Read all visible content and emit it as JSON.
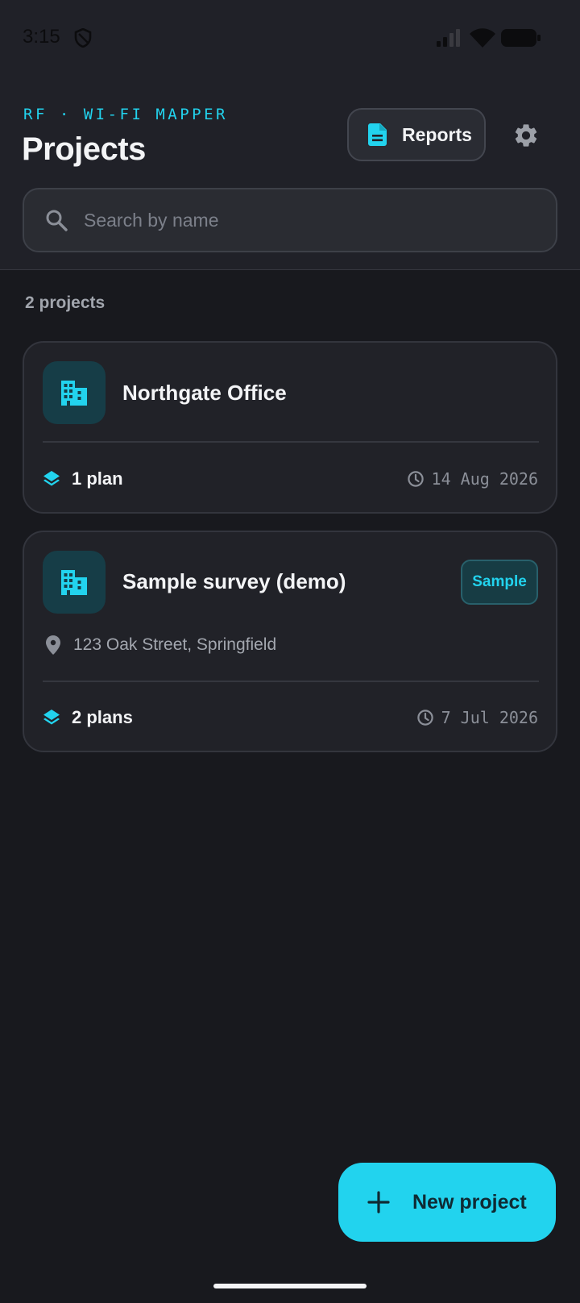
{
  "status_bar": {
    "time": "3:15",
    "shield_icon": "shield-icon",
    "signal_icon": "cellular-signal-icon",
    "wifi_icon": "wifi-icon",
    "battery_icon": "battery-icon"
  },
  "header": {
    "subtitle": "RF · WI-FI MAPPER",
    "title": "Projects",
    "reports_label": "Reports",
    "reports_icon": "document-icon",
    "settings_icon": "gear-icon"
  },
  "search": {
    "placeholder": "Search by name",
    "value": "",
    "icon": "search-icon"
  },
  "list": {
    "count_label": "2 projects",
    "projects": [
      {
        "name": "Northgate Office",
        "icon": "building-icon",
        "address": "",
        "badge": "",
        "plans": "1 plan",
        "date": "14 Aug 2026"
      },
      {
        "name": "Sample survey (demo)",
        "icon": "building-icon",
        "address": "123 Oak Street, Springfield",
        "badge": "Sample",
        "plans": "2 plans",
        "date": "7 Jul 2026"
      }
    ]
  },
  "fab": {
    "label": "New project",
    "icon": "plus-icon"
  },
  "colors": {
    "accent": "#22d3ee",
    "background": "#18191e",
    "header": "#202128",
    "card": "#212228"
  }
}
